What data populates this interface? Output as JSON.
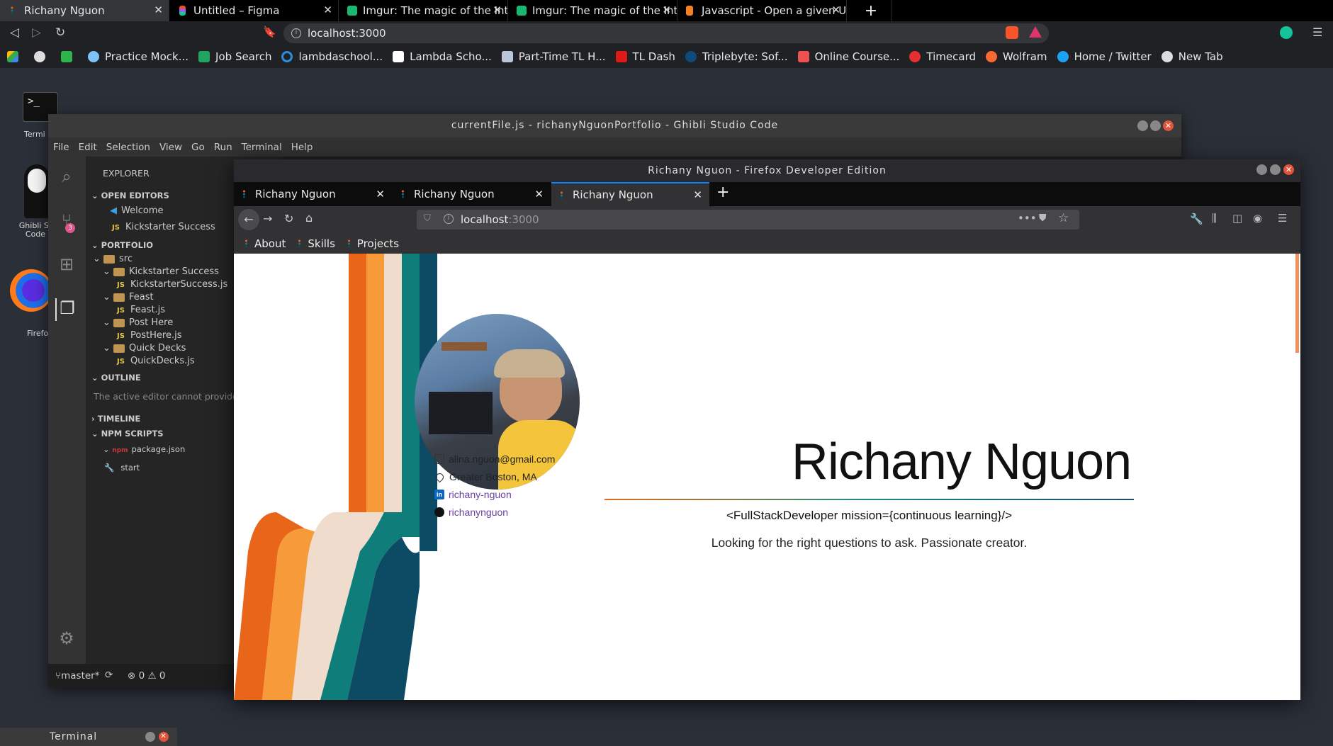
{
  "outer_browser": {
    "tabs": [
      {
        "title": "Richany Nguon",
        "icon": "dots-favicon",
        "active": true
      },
      {
        "title": "Untitled – Figma",
        "icon": "figma-favicon"
      },
      {
        "title": "Imgur: The magic of the Int",
        "icon": "imgur-favicon"
      },
      {
        "title": "Imgur: The magic of the Int",
        "icon": "imgur-favicon"
      },
      {
        "title": "Javascript - Open a given U",
        "icon": "stackoverflow-favicon"
      }
    ],
    "url": "localhost:3000",
    "bookmarks": [
      {
        "label": "",
        "icon": "google-drive-icon"
      },
      {
        "label": "",
        "icon": "globe-icon"
      },
      {
        "label": "",
        "icon": "green-app-icon"
      },
      {
        "label": "Practice Mock...",
        "icon": "shield-check-icon"
      },
      {
        "label": "Job Search",
        "icon": "plus-icon"
      },
      {
        "label": "lambdaschool...",
        "icon": "circle-icon"
      },
      {
        "label": "Lambda Scho...",
        "icon": "notion-icon"
      },
      {
        "label": "Part-Time TL H...",
        "icon": "page-icon"
      },
      {
        "label": "TL Dash",
        "icon": "angular-icon"
      },
      {
        "label": "Triplebyte: Sof...",
        "icon": "triplebyte-icon"
      },
      {
        "label": "Online Course...",
        "icon": "udemy-icon"
      },
      {
        "label": "Timecard",
        "icon": "timecard-icon"
      },
      {
        "label": "Wolfram",
        "icon": "wolfram-icon"
      },
      {
        "label": "Home / Twitter",
        "icon": "twitter-icon"
      },
      {
        "label": "New Tab",
        "icon": "globe-icon"
      }
    ]
  },
  "desktop": {
    "icons": [
      {
        "label": "Termi",
        "icon": "terminal-icon"
      },
      {
        "label": "Ghibli St\nCode",
        "icon": "no-face-icon"
      },
      {
        "label": "Firefo",
        "icon": "firefox-icon"
      }
    ]
  },
  "vscode": {
    "title": "currentFile.js - richanyNguonPortfolio - Ghibli Studio Code",
    "menu": [
      "File",
      "Edit",
      "Selection",
      "View",
      "Go",
      "Run",
      "Terminal",
      "Help"
    ],
    "explorer_label": "EXPLORER",
    "open_editors_label": "OPEN EDITORS",
    "open_editors": [
      "Welcome",
      "Kickstarter Success"
    ],
    "portfolio_label": "PORTFOLIO",
    "tree": {
      "src": "src",
      "folders": [
        {
          "name": "Kickstarter Success",
          "file": "KickstarterSuccess.js"
        },
        {
          "name": "Feast",
          "file": "Feast.js"
        },
        {
          "name": "Post Here",
          "file": "PostHere.js"
        },
        {
          "name": "Quick Decks",
          "file": "QuickDecks.js"
        }
      ]
    },
    "outline_label": "OUTLINE",
    "outline_msg": "The active editor cannot provide o",
    "timeline_label": "TIMELINE",
    "npm_label": "NPM SCRIPTS",
    "npm_file": "package.json",
    "npm_script": "start",
    "scm_badge": "3",
    "status": {
      "branch": "master*",
      "errors": "0",
      "warnings": "0"
    }
  },
  "firefox": {
    "title": "Richany Nguon - Firefox Developer Edition",
    "tabs": [
      {
        "title": "Richany Nguon"
      },
      {
        "title": "Richany Nguon"
      },
      {
        "title": "Richany Nguon",
        "active": true
      }
    ],
    "url_host": "localhost",
    "url_port": ":3000",
    "bookmarks": [
      "About",
      "Skills",
      "Projects"
    ]
  },
  "page": {
    "name": "Richany Nguon",
    "tagline": "<FullStackDeveloper mission={continuous learning}/>",
    "blurb": "Looking for the right questions to ask. Passionate creator.",
    "email": "alina.nguon@gmail.com",
    "location": "Greater Boston, MA",
    "linkedin": "richany-nguon",
    "github": "richanynguon",
    "stripe_colors": [
      "#e8651a",
      "#f79a3a",
      "#efdccc",
      "#0f7d7a",
      "#0d4a64"
    ]
  },
  "terminal_bar": {
    "label": "Terminal"
  }
}
